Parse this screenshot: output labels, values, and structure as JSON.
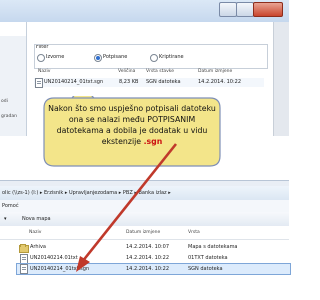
{
  "top_window": {
    "filter": {
      "title": "Filter",
      "options": [
        {
          "label": "Izvorne",
          "selected": false
        },
        {
          "label": "Potpisane",
          "selected": true
        },
        {
          "label": "Kriptirane",
          "selected": false
        }
      ]
    },
    "columns": [
      "Naziv",
      "Veličina",
      "Vrsta stavke",
      "Datum izmjene"
    ],
    "files": [
      {
        "name": "UN20140214_01txt.sgn",
        "size": "8,23 KB",
        "type": "SGN datoteka",
        "date": "14.2.2014. 10:22"
      }
    ],
    "side_fragments": [
      "odi",
      "gradan"
    ]
  },
  "callout": {
    "lines": [
      "Nakon što smo uspješno potpisali datoteku",
      "ona se nalazi među POTPISANIM",
      "datotekama   a dobila je dodatak u vidu",
      "ekstenzije "
    ],
    "highlight": ".sgn",
    "highlight_color": "#cc1111"
  },
  "bottom_window": {
    "address": {
      "path": "olic (\\\\zs-1) (I:)  ▸ Erzisnik  ▸ Upravljanjezodama  ▸ PBZ  ▸ Banka izlaz  ▸",
      "separator": "▸"
    },
    "menu": {
      "help": "Pomoć"
    },
    "toolbar": {
      "dropdown": "▾",
      "new_folder": "Nova mapa"
    },
    "columns": [
      "Naziv",
      "Datum izmjene",
      "Vrsta"
    ],
    "files": [
      {
        "name": "Arhiva",
        "date": "14.2.2014. 10:07",
        "type": "Mapa s datotekama",
        "kind": "folder"
      },
      {
        "name": "UN20140214.01txt",
        "date": "14.2.2014. 10:22",
        "type": "01TXT datoteka",
        "kind": "file"
      },
      {
        "name": "UN20140214_01txt.sgn",
        "date": "14.2.2014. 10:22",
        "type": "SGN datoteka",
        "kind": "file",
        "selected": true
      }
    ]
  },
  "colors": {
    "arrow": "#c0392b",
    "callout_fill": "#f3e58a",
    "callout_border": "#7f8fb6"
  }
}
